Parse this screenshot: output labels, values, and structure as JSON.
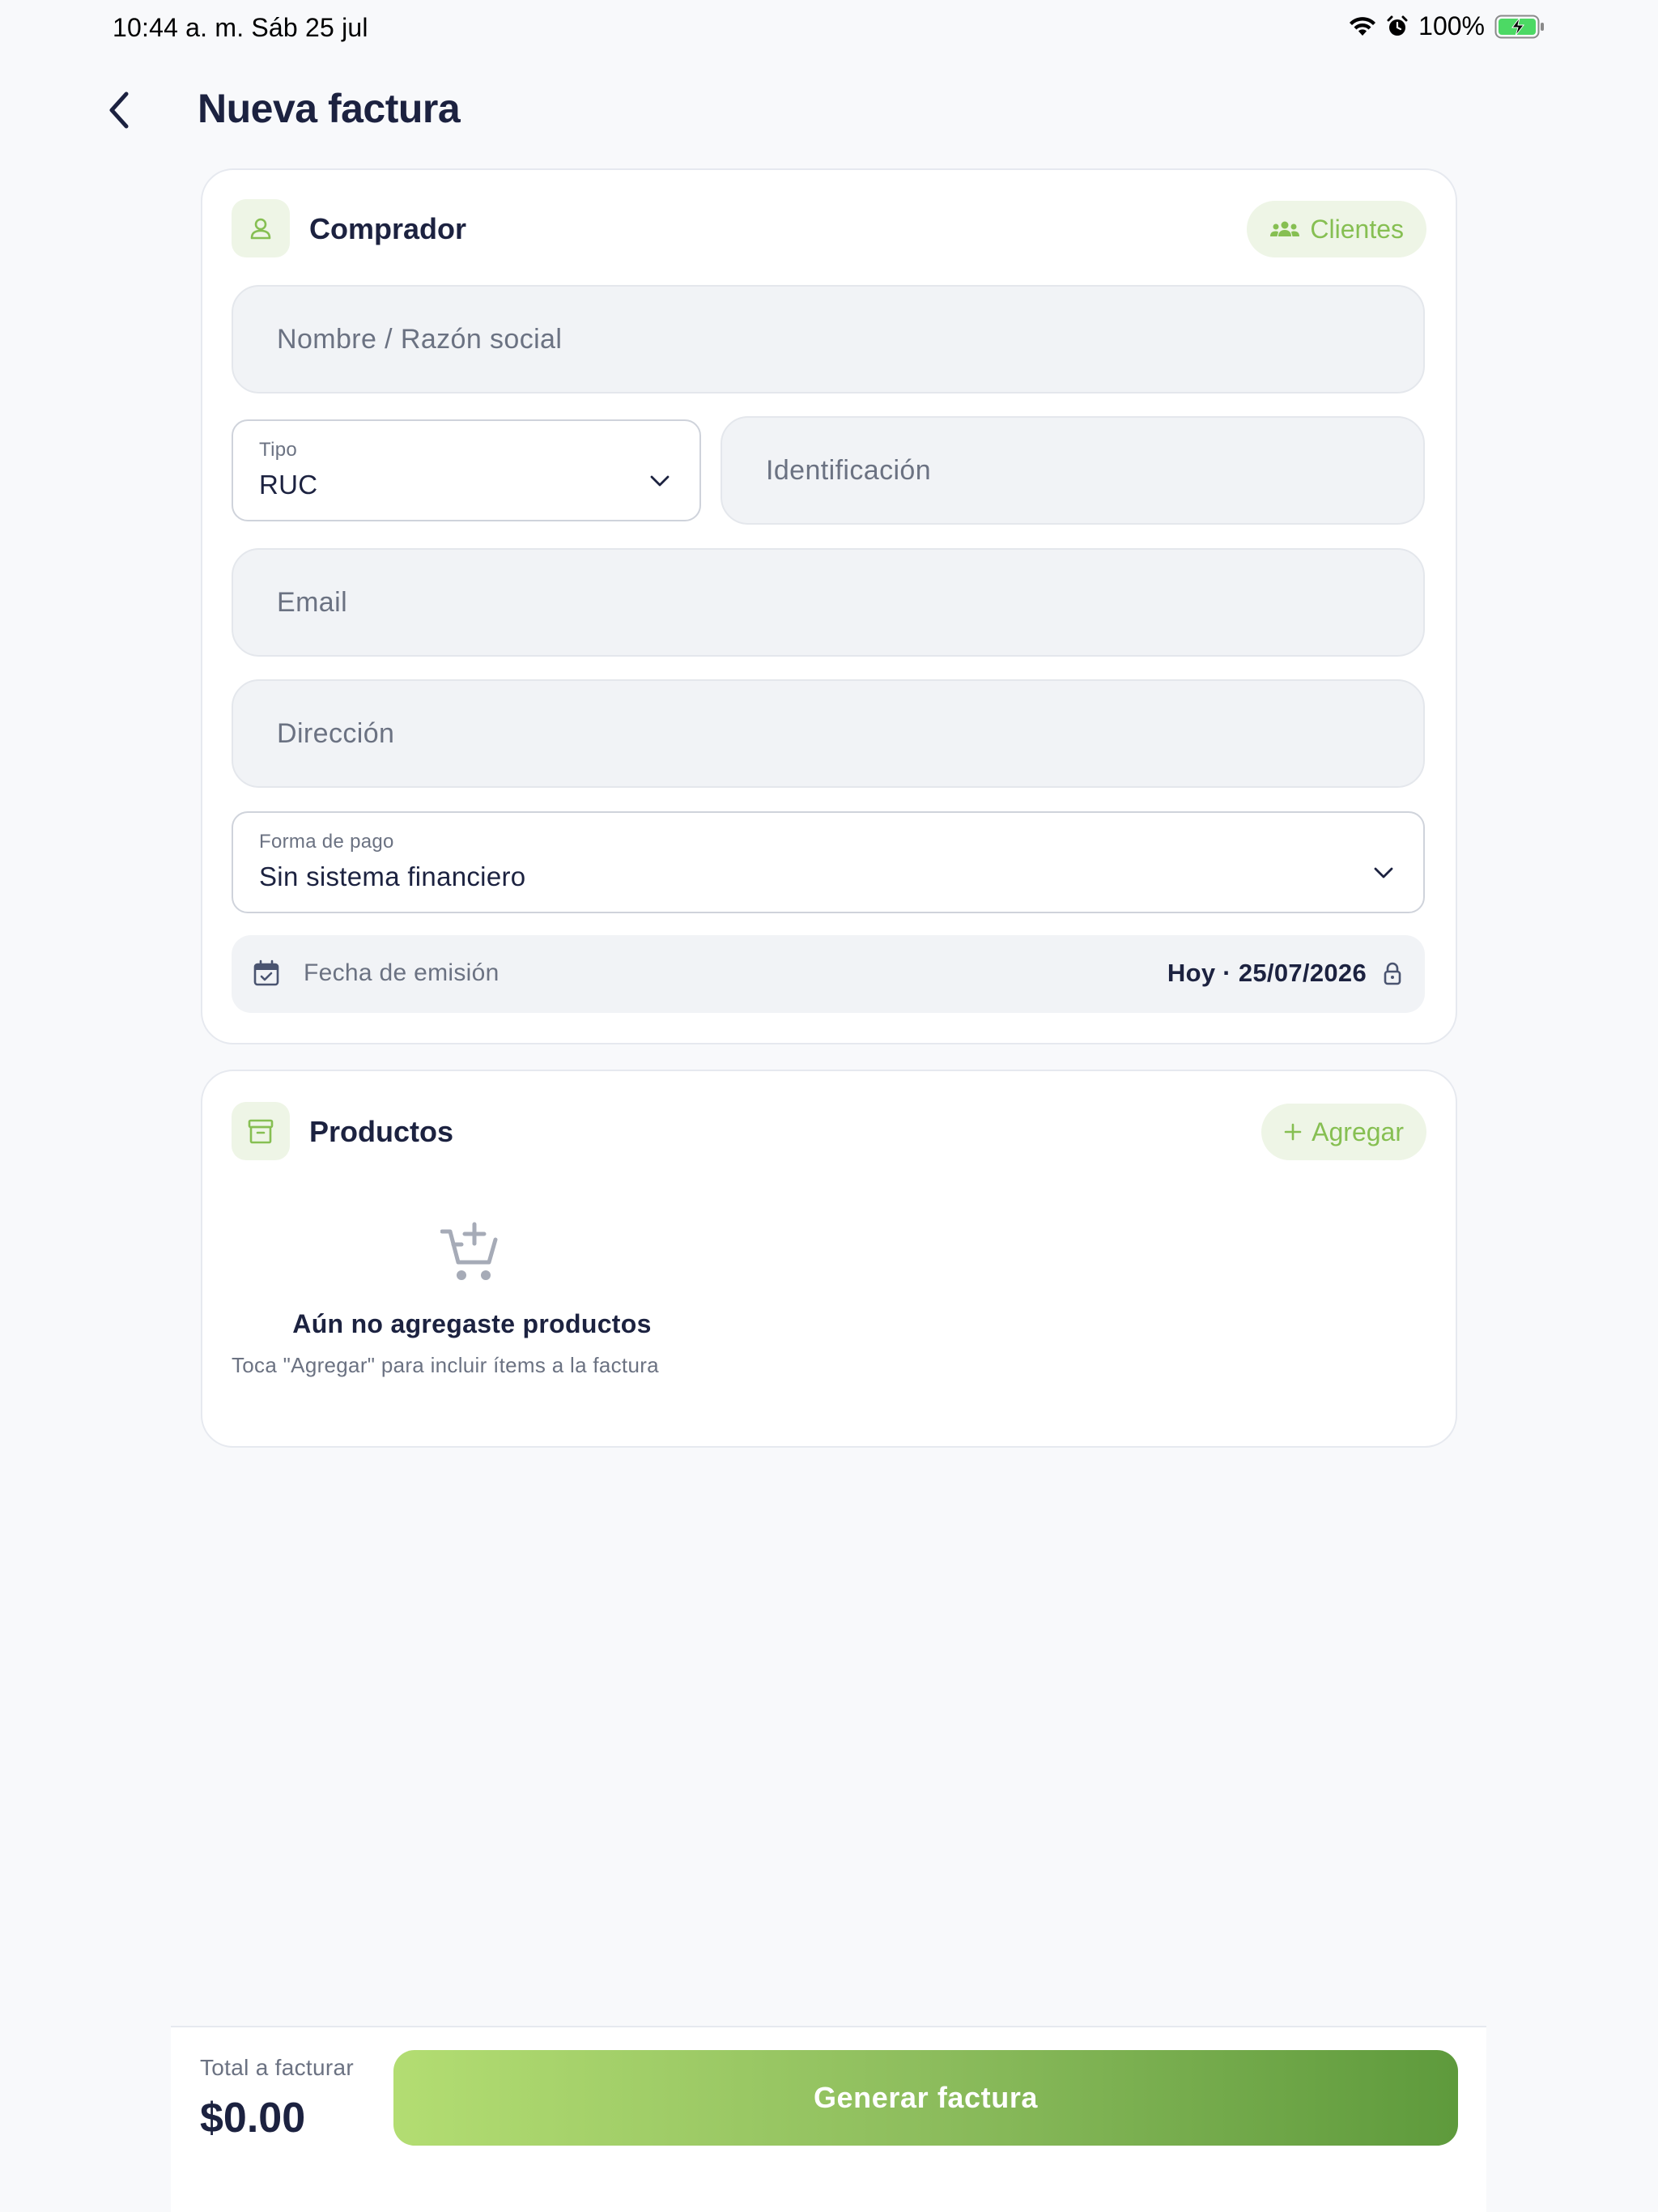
{
  "status_bar": {
    "time": "10:44 a. m.   Sáb 25 jul",
    "battery": "100%"
  },
  "header": {
    "title": "Nueva factura",
    "back_icon": "chevron-left-icon"
  },
  "buyer": {
    "title": "Comprador",
    "icon": "user-icon",
    "clients_button": "Clientes",
    "name_placeholder": "Nombre / Razón social",
    "type_label": "Tipo",
    "type_value": "RUC",
    "id_placeholder": "Identificación",
    "email_placeholder": "Email",
    "address_placeholder": "Dirección",
    "payment_label": "Forma de pago",
    "payment_value": "Sin sistema financiero",
    "date_label": "Fecha de emisión",
    "date_value": "Hoy · 25/07/2026"
  },
  "products": {
    "title": "Productos",
    "icon": "archive-icon",
    "add_button": "Agregar",
    "empty_title": "Aún no agregaste productos",
    "empty_subtitle": "Toca \"Agregar\" para incluir ítems a la factura"
  },
  "footer": {
    "total_label": "Total a facturar",
    "total_value": "$0.00",
    "generate_button": "Generar factura"
  },
  "colors": {
    "accent": "#86bf52",
    "accent_bg": "#eef5e6",
    "title": "#1c2240",
    "muted": "#6b7282",
    "button_gradient": [
      "#b3dd72",
      "#5e9a3c"
    ]
  }
}
